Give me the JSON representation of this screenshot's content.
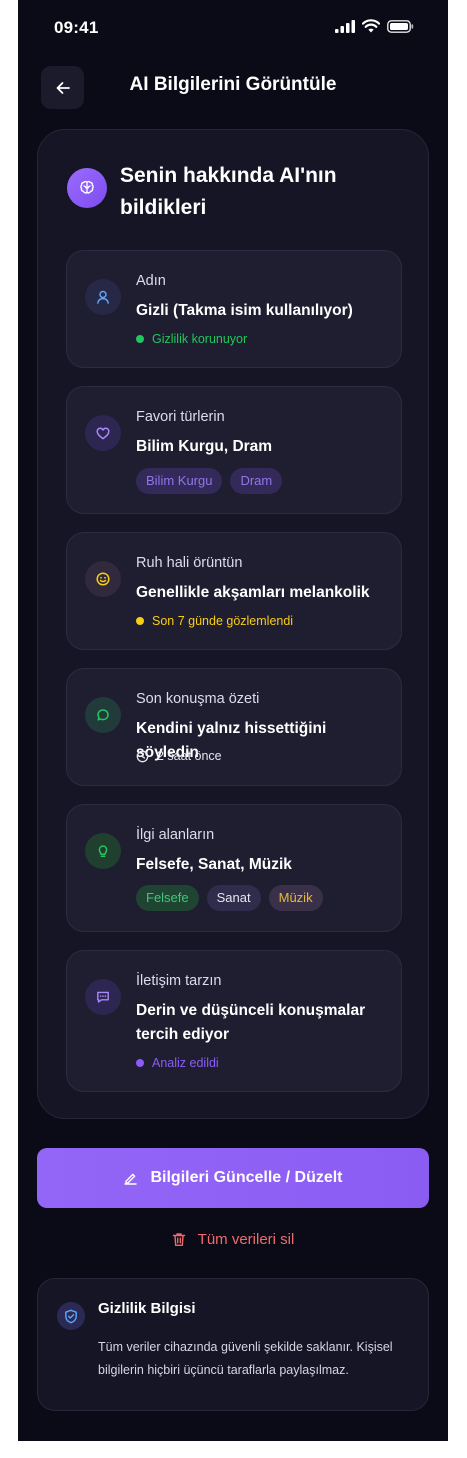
{
  "status_bar": {
    "time": "09:41"
  },
  "header": {
    "title": "AI Bilgilerini Görüntüle"
  },
  "card": {
    "title": "Senin hakkında AI'nın bildikleri",
    "items": [
      {
        "label": "Adın",
        "value": "Gizli (Takma isim kullanılıyor)",
        "meta": "Gizlilik korunuyor",
        "icon": "user-icon",
        "color": "#22c55e"
      },
      {
        "label": "Favori türlerin",
        "value": "Bilim Kurgu, Dram",
        "chips": [
          "Bilim Kurgu",
          "Dram"
        ],
        "icon": "heart-icon",
        "color": "#8b5cf6"
      },
      {
        "label": "Ruh hali örüntün",
        "value": "Genellikle akşamları melankolik",
        "meta": "Son 7 günde gözlemlendi",
        "icon": "smile-icon",
        "color": "#facc15"
      },
      {
        "label": "Son konuşma özeti",
        "value": "Kendini yalnız hissettiğini söyledin",
        "meta": "2 saat önce",
        "icon": "chat-icon",
        "color": "#22c55e"
      },
      {
        "label": "İlgi alanların",
        "value": "Felsefe, Sanat, Müzik",
        "chips": [
          "Felsefe",
          "Sanat",
          "Müzik"
        ],
        "icon": "lightbulb-icon",
        "color": "#22c55e"
      },
      {
        "label": "İletişim tarzın",
        "value": "Derin ve düşünceli konuşmalar tercih ediyor",
        "meta": "Analiz edildi",
        "icon": "message-dots-icon",
        "color": "#8b5cf6"
      }
    ]
  },
  "actions": {
    "update_label": "Bilgileri Güncelle / Düzelt",
    "delete_label": "Tüm verileri sil"
  },
  "privacy": {
    "title": "Gizlilik Bilgisi",
    "text": "Tüm veriler cihazında güvenli şekilde saklanır. Kişisel bilgilerin hiçbiri üçüncü taraflarla paylaşılmaz."
  },
  "colors": {
    "accent": "#8b5cf6",
    "background": "#0b0b17",
    "card": "#151525",
    "danger": "#ef6b6b"
  }
}
